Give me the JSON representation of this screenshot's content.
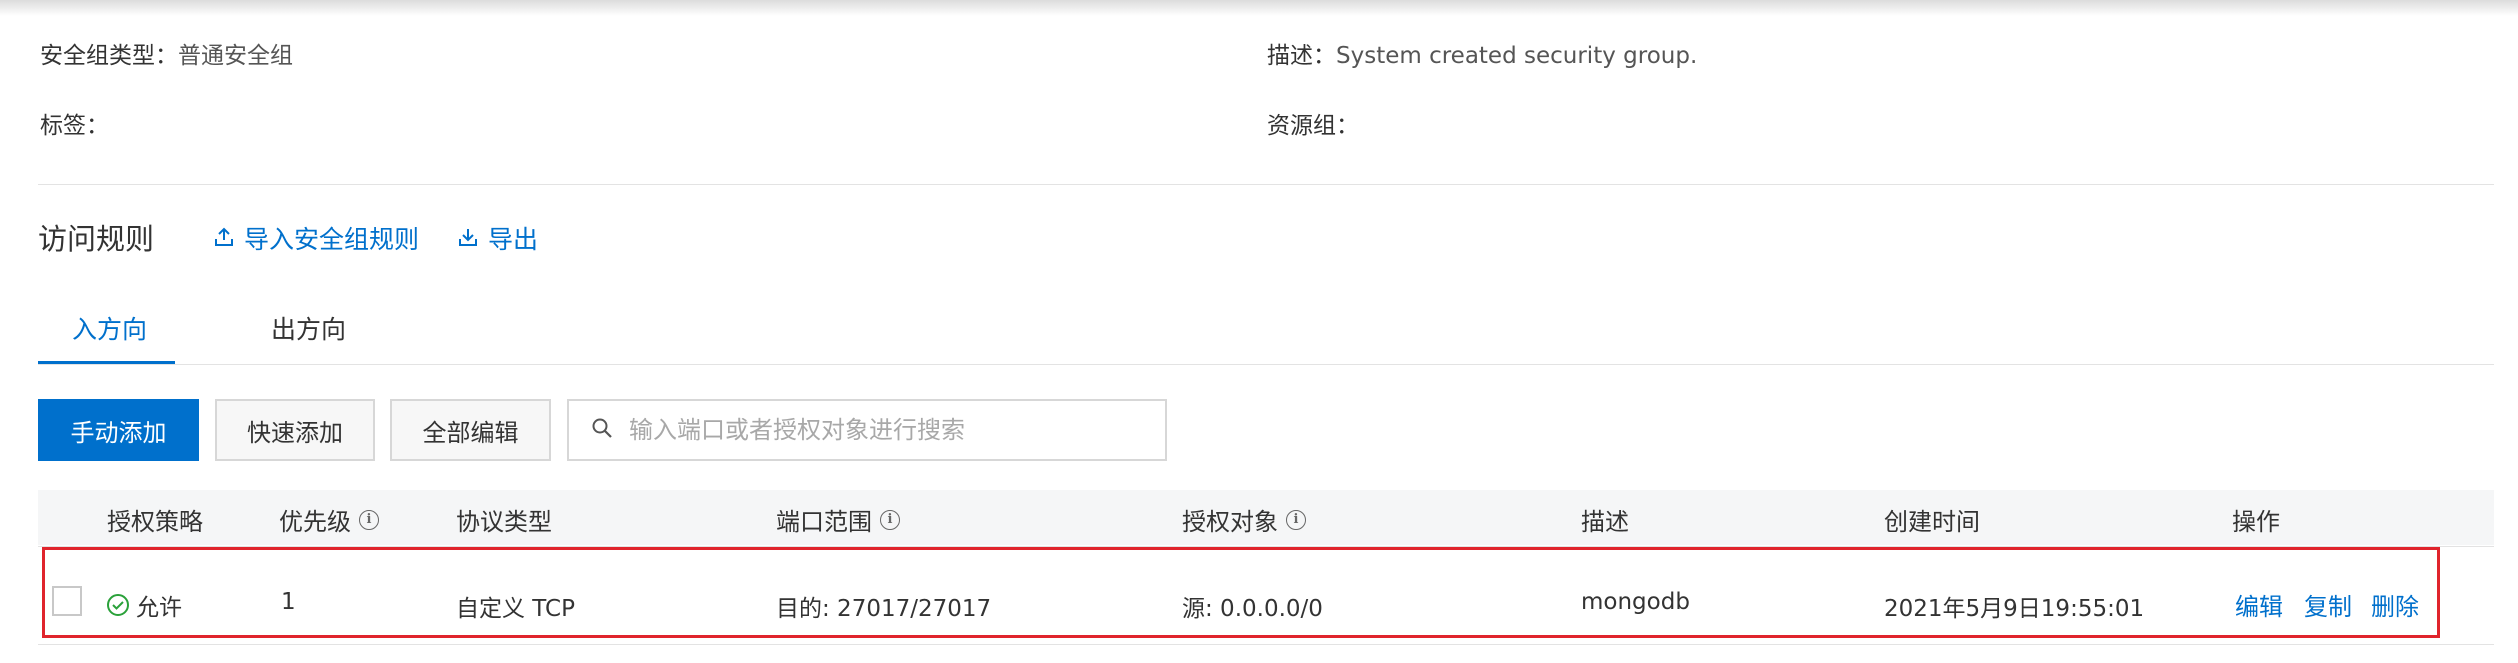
{
  "info": {
    "sg_type_label": "安全组类型：",
    "sg_type_value": "普通安全组",
    "desc_label": "描述：",
    "desc_value": "System created security group.",
    "tags_label": "标签：",
    "resource_group_label": "资源组："
  },
  "rules_section": {
    "title": "访问规则",
    "import_label": "导入安全组规则",
    "export_label": "导出"
  },
  "tabs": [
    {
      "label": "入方向",
      "active": true
    },
    {
      "label": "出方向",
      "active": false
    }
  ],
  "toolbar": {
    "manual_add": "手动添加",
    "quick_add": "快速添加",
    "edit_all": "全部编辑",
    "search_placeholder": "输入端口或者授权对象进行搜索"
  },
  "table": {
    "columns": [
      "授权策略",
      "优先级",
      "协议类型",
      "端口范围",
      "授权对象",
      "描述",
      "创建时间",
      "操作"
    ],
    "rows": [
      {
        "policy": "允许",
        "priority": "1",
        "protocol": "自定义 TCP",
        "port_range": "目的: 27017/27017",
        "target": "源: 0.0.0.0/0",
        "description": "mongodb",
        "created": "2021年5月9日19:55:01",
        "actions": [
          "编辑",
          "复制",
          "删除"
        ]
      }
    ]
  },
  "colors": {
    "accent": "#0070cc",
    "highlight_border": "#e0242c",
    "success": "#2aa13a"
  },
  "icons": {
    "import": "upload-icon",
    "export": "download-icon",
    "search": "search-icon",
    "info": "info-icon",
    "allow": "check-circle-icon"
  }
}
